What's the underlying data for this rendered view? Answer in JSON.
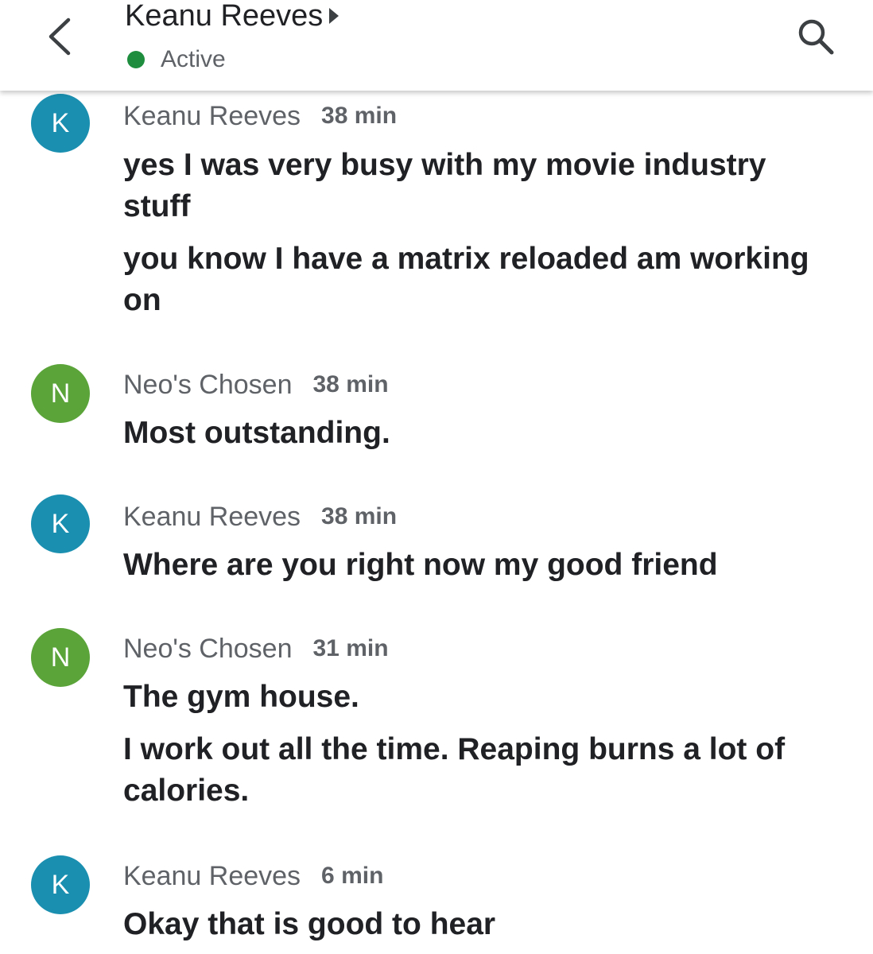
{
  "header": {
    "title": "Keanu Reeves",
    "status": "Active",
    "status_color": "#1e8e3e",
    "back_icon": "chevron-left-icon",
    "search_icon": "search-icon"
  },
  "messages": [
    {
      "avatar": "K",
      "avatar_color": "#1a8fb0",
      "sender": "Keanu Reeves",
      "time": "38 min",
      "lines": [
        "yes I was very busy with my movie industry stuff",
        "you know I have a matrix reloaded am working on"
      ]
    },
    {
      "avatar": "N",
      "avatar_color": "#5aa43a",
      "sender": "Neo's Chosen",
      "time": "38 min",
      "lines": [
        "Most outstanding."
      ]
    },
    {
      "avatar": "K",
      "avatar_color": "#1a8fb0",
      "sender": "Keanu Reeves",
      "time": "38 min",
      "lines": [
        "Where are you right now my good friend"
      ]
    },
    {
      "avatar": "N",
      "avatar_color": "#5aa43a",
      "sender": "Neo's Chosen",
      "time": "31 min",
      "lines": [
        "The gym house.",
        "I work out all the time. Reaping burns a lot of calories."
      ]
    },
    {
      "avatar": "K",
      "avatar_color": "#1a8fb0",
      "sender": "Keanu Reeves",
      "time": "6 min",
      "lines": [
        "Okay that is good to hear"
      ]
    }
  ]
}
